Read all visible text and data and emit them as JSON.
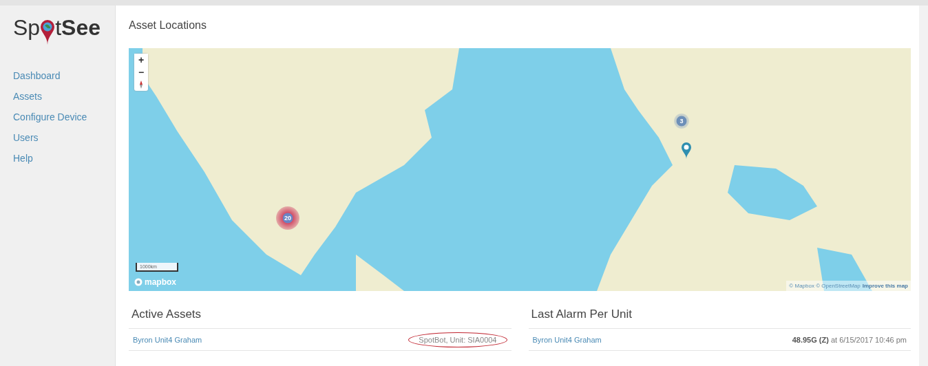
{
  "logo": {
    "before": "Sp",
    "after": "t",
    "bold": "See"
  },
  "sidebar": {
    "items": [
      {
        "label": "Dashboard"
      },
      {
        "label": "Assets"
      },
      {
        "label": "Configure Device"
      },
      {
        "label": "Users"
      },
      {
        "label": "Help"
      }
    ]
  },
  "page_title": "Asset Locations",
  "map": {
    "zoom_in": "+",
    "zoom_out": "−",
    "scale": "1000km",
    "logo": "mapbox",
    "attribution": "© Mapbox © OpenStreetMap",
    "improve_link": "Improve this map",
    "clusters": [
      {
        "count": "20",
        "kind": "hot"
      },
      {
        "count": "3",
        "kind": "plain"
      }
    ]
  },
  "active_assets": {
    "title": "Active Assets",
    "rows": [
      {
        "name": "Byron Unit4 Graham",
        "unit": "SpotBot,  Unit: SIA0004",
        "circled": true
      }
    ]
  },
  "last_alarm": {
    "title": "Last Alarm Per Unit",
    "rows": [
      {
        "name": "Byron Unit4 Graham",
        "reading": "**48.95G (Z)** at 6/15/2017 10:46 pm"
      }
    ]
  }
}
